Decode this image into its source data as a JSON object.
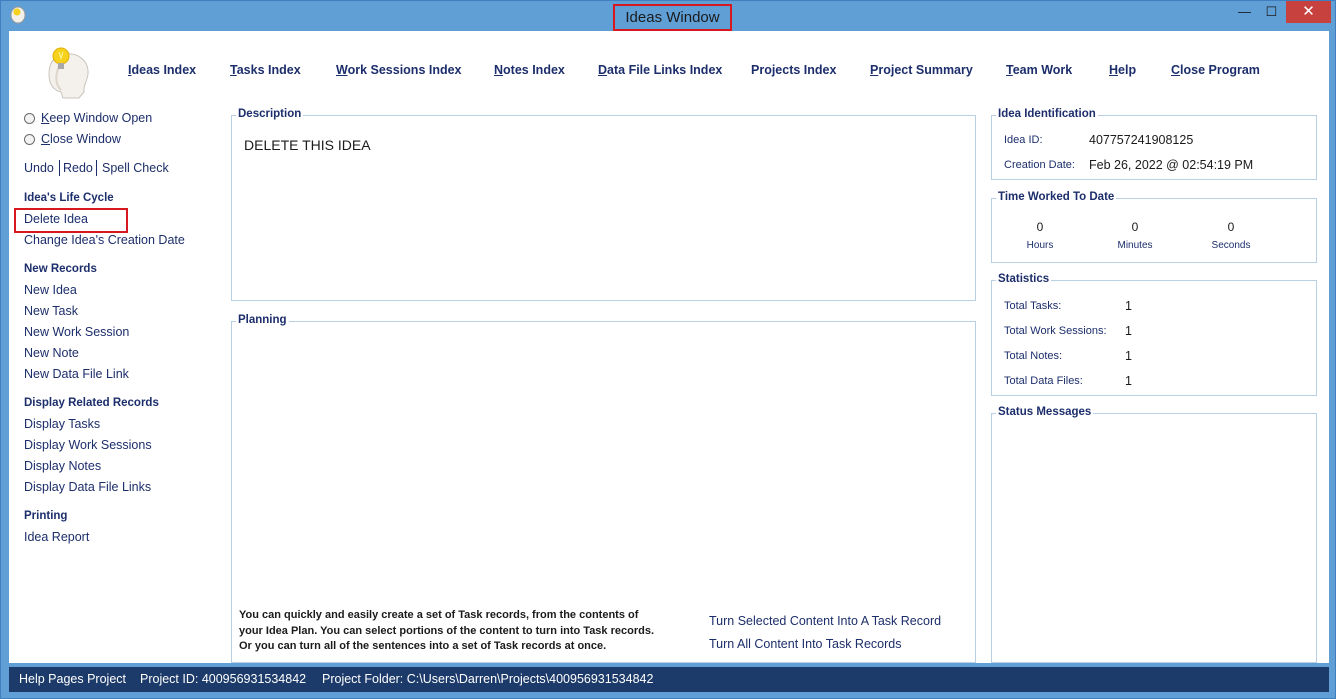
{
  "window": {
    "title": "Ideas Window",
    "min_glyph": "—",
    "max_glyph": "☐",
    "close_glyph": "✕"
  },
  "topnav": [
    {
      "underline": "I",
      "rest": "deas Index"
    },
    {
      "underline": "T",
      "rest": "asks Index"
    },
    {
      "underline": "W",
      "rest": "ork Sessions Index"
    },
    {
      "underline": "N",
      "rest": "otes Index"
    },
    {
      "underline": "D",
      "rest": "ata File Links Index"
    },
    {
      "underline": "",
      "rest": "Projects Index"
    },
    {
      "underline": "P",
      "rest": "roject Summary"
    },
    {
      "underline": "T",
      "rest": "eam Work"
    },
    {
      "underline": "H",
      "rest": "elp"
    },
    {
      "underline": "C",
      "rest": "lose Program"
    }
  ],
  "sidebar": {
    "keep_open": {
      "underline": "K",
      "rest": "eep Window Open"
    },
    "close_window": {
      "underline": "C",
      "rest": "lose Window"
    },
    "undo": "Undo",
    "redo": "Redo",
    "spell_check": "Spell Check",
    "life_cycle_heading": "Idea's Life Cycle",
    "delete_idea": "Delete Idea",
    "change_date": "Change Idea's Creation Date",
    "new_records_heading": "New Records",
    "new_idea": "New Idea",
    "new_task": "New Task",
    "new_work_session": "New Work Session",
    "new_note": "New Note",
    "new_data_file_link": "New Data File Link",
    "display_heading": "Display Related Records",
    "display_tasks": "Display Tasks",
    "display_work_sessions": "Display Work Sessions",
    "display_notes": "Display Notes",
    "display_data_file_links": "Display Data File Links",
    "printing_heading": "Printing",
    "idea_report": "Idea Report"
  },
  "description": {
    "title": "Description",
    "text": "DELETE THIS IDEA"
  },
  "planning": {
    "title": "Planning",
    "note_line1": "You can quickly and easily create a set of Task records, from the contents of",
    "note_line2": "your Idea Plan. You can select portions of the content to turn into Task records.",
    "note_line3": "Or you can turn all of the sentences into a set of Task records at once.",
    "link_selected": "Turn Selected Content Into A Task Record",
    "link_all": "Turn All Content Into Task Records"
  },
  "identification": {
    "title": "Idea Identification",
    "id_label": "Idea ID:",
    "id_value": "407757241908125",
    "date_label": "Creation Date:",
    "date_value": "Feb  26, 2022 @ 02:54:19 PM"
  },
  "time_worked": {
    "title": "Time Worked To Date",
    "hours": "0",
    "hours_label": "Hours",
    "minutes": "0",
    "minutes_label": "Minutes",
    "seconds": "0",
    "seconds_label": "Seconds"
  },
  "statistics": {
    "title": "Statistics",
    "tasks_label": "Total Tasks:",
    "tasks": "1",
    "sessions_label": "Total Work Sessions:",
    "sessions": "1",
    "notes_label": "Total Notes:",
    "notes": "1",
    "files_label": "Total Data Files:",
    "files": "1"
  },
  "status_messages": {
    "title": "Status Messages"
  },
  "statusbar": {
    "project": "Help Pages Project",
    "project_id": "Project ID:  400956931534842",
    "folder": "Project Folder: C:\\Users\\Darren\\Projects\\400956931534842"
  },
  "colors": {
    "accent_red": "#d7191f",
    "nav_text": "#1c2e6b",
    "status_bg": "#1d3b6a",
    "frame": "#5f9fd6"
  }
}
